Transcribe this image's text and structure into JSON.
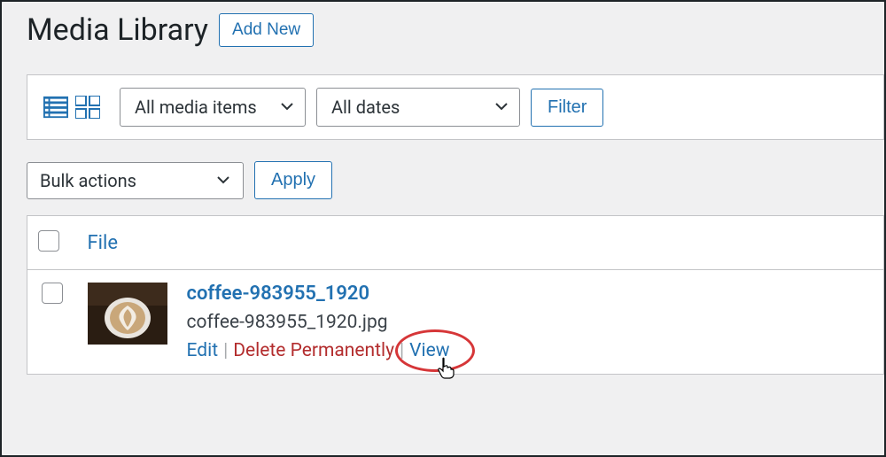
{
  "header": {
    "title": "Media Library",
    "add_new_label": "Add New"
  },
  "toolbar": {
    "media_filter_selected": "All media items",
    "date_filter_selected": "All dates",
    "filter_label": "Filter",
    "bulk_selected": "Bulk actions",
    "apply_label": "Apply"
  },
  "table": {
    "columns": {
      "file": "File"
    },
    "rows": [
      {
        "title": "coffee-983955_1920",
        "filename": "coffee-983955_1920.jpg",
        "actions": {
          "edit": "Edit",
          "delete": "Delete Permanently",
          "view": "View"
        }
      }
    ]
  }
}
